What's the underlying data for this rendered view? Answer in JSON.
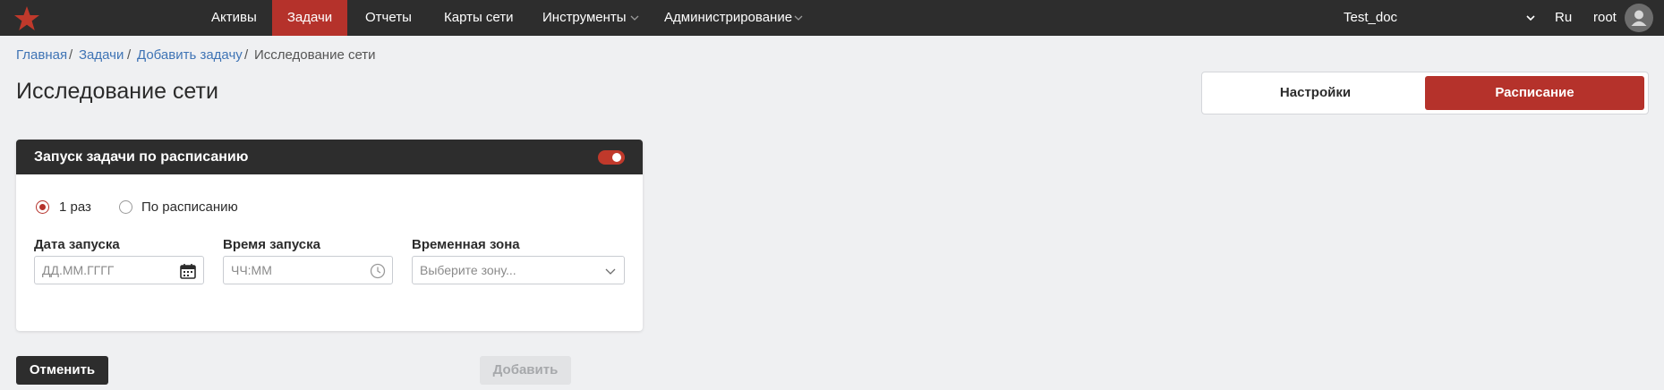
{
  "nav": {
    "items": [
      "Активы",
      "Задачи",
      "Отчеты",
      "Карты сети",
      "Инструменты",
      "Администрирование"
    ],
    "active_index": 1,
    "project": "Test_doc",
    "language": "Ru",
    "user": "root"
  },
  "breadcrumb": {
    "items": [
      "Главная",
      "Задачи",
      "Добавить задачу",
      "Исследование сети"
    ],
    "separator": "/"
  },
  "page": {
    "title": "Исследование сети"
  },
  "tabs": {
    "items": [
      "Настройки",
      "Расписание"
    ],
    "active_index": 1
  },
  "schedule": {
    "title": "Запуск задачи по расписанию",
    "toggle_on": true,
    "modes": [
      "1 раз",
      "По расписанию"
    ],
    "selected_mode_index": 0,
    "date": {
      "label": "Дата запуска",
      "placeholder": "ДД.ММ.ГГГГ",
      "value": ""
    },
    "time": {
      "label": "Время запуска",
      "placeholder": "ЧЧ:ММ",
      "value": ""
    },
    "timezone": {
      "label": "Временная зона",
      "placeholder": "Выберите зону..."
    }
  },
  "actions": {
    "cancel": "Отменить",
    "add": "Добавить",
    "add_disabled": true
  },
  "colors": {
    "accent": "#b5322b",
    "topbar": "#2d2d2d",
    "link": "#3f74b5",
    "background": "#eff0f2"
  },
  "icons": [
    "star-logo-icon",
    "chevron-down-icon",
    "user-avatar-icon",
    "calendar-icon",
    "clock-icon"
  ]
}
